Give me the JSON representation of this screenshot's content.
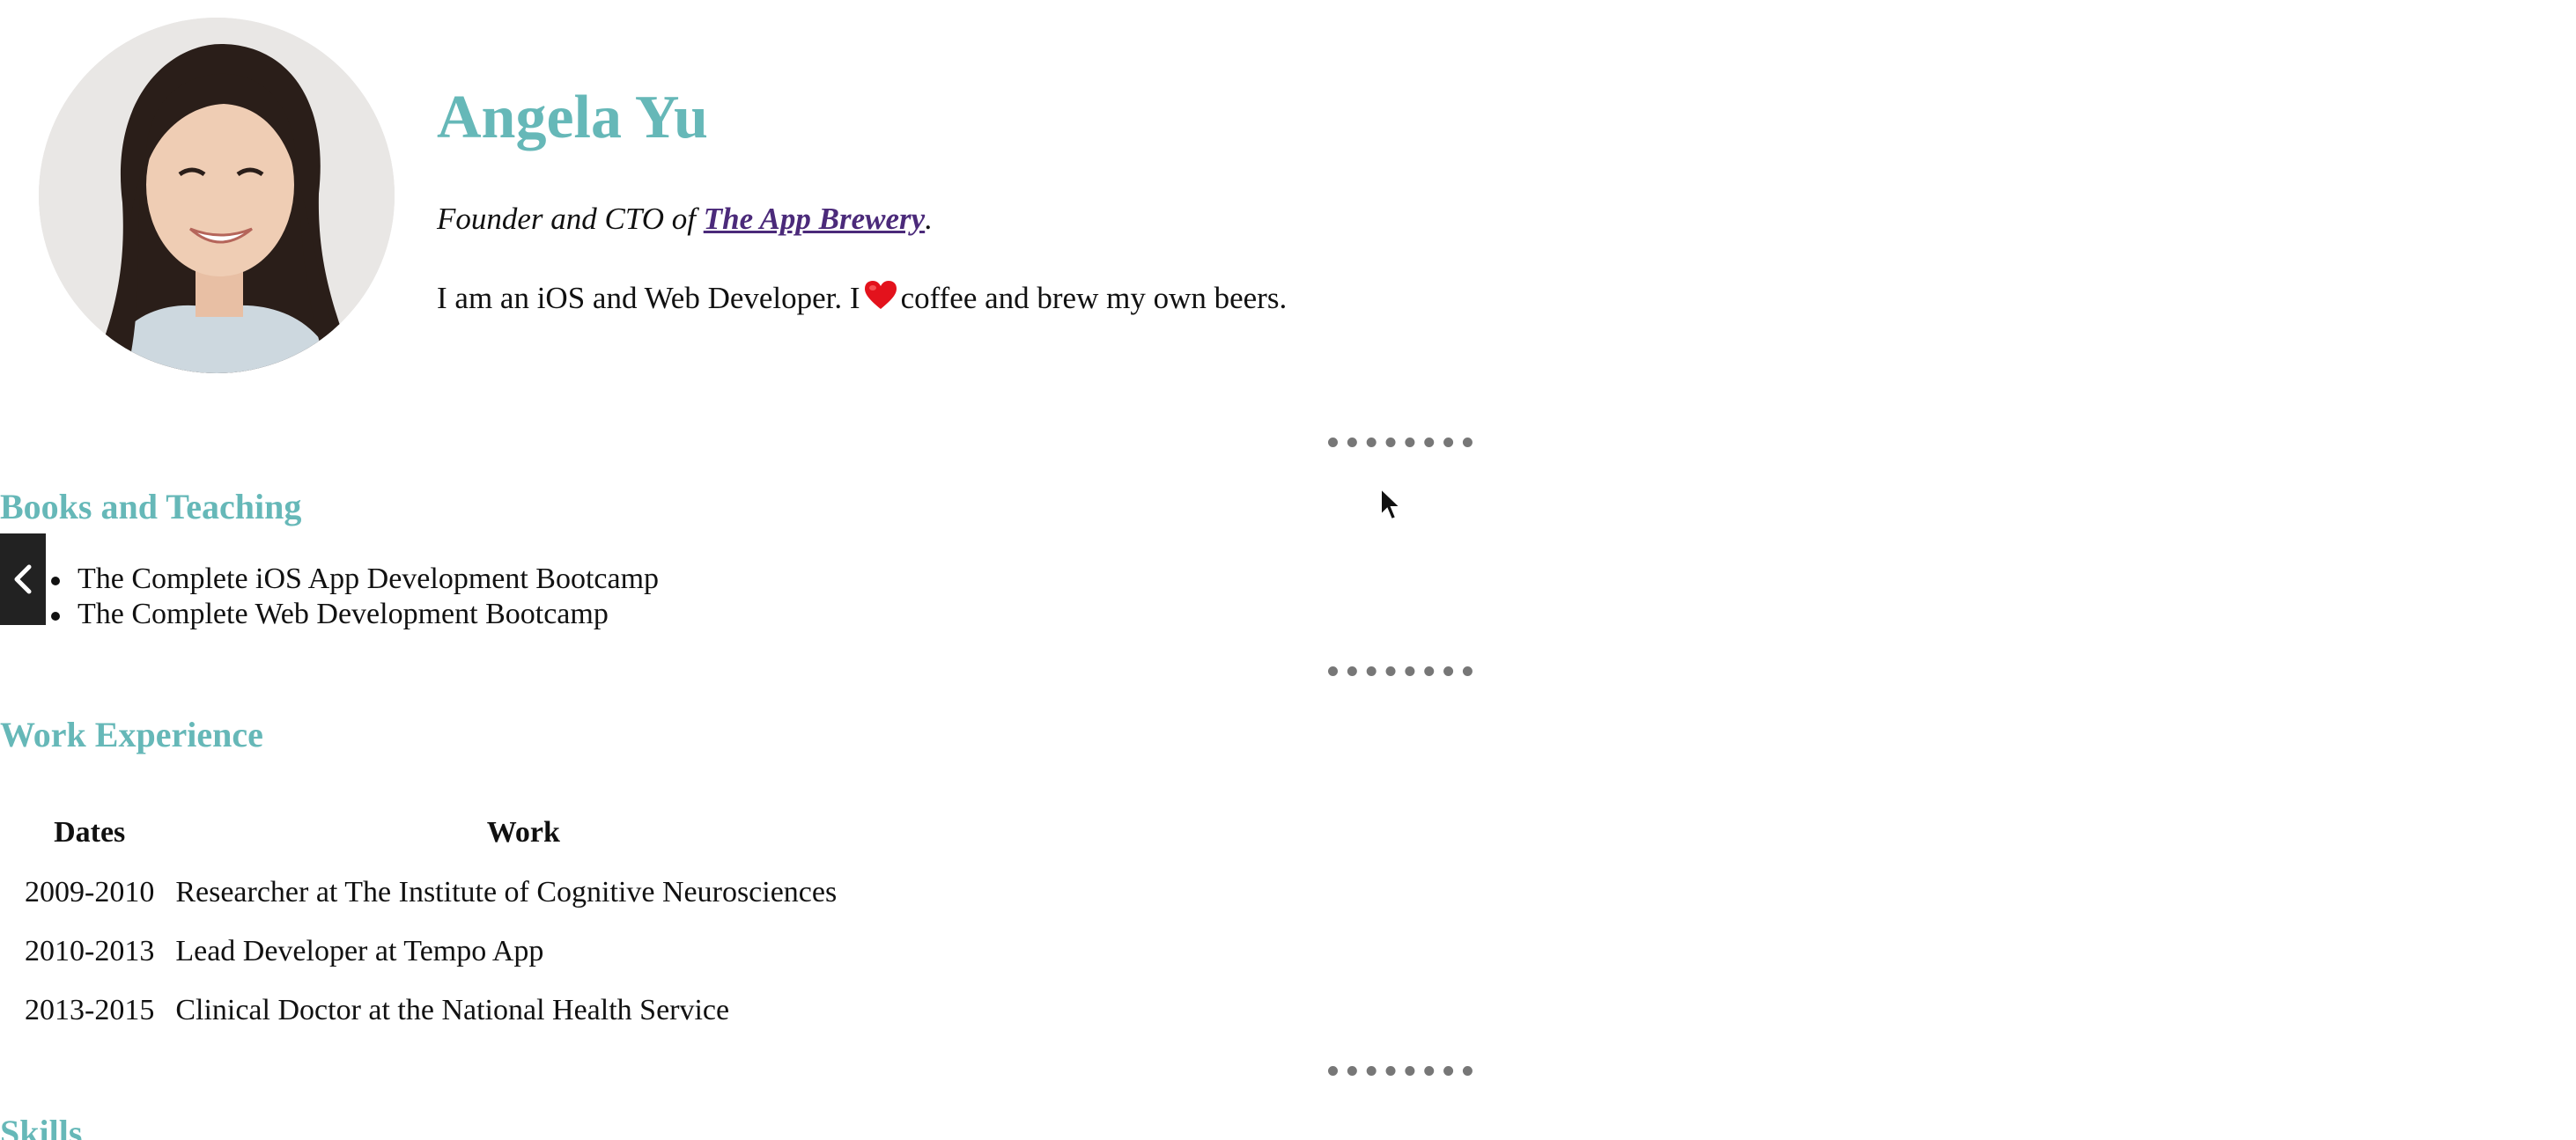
{
  "profile": {
    "name": "Angela Yu",
    "tagline_prefix": "Founder and CTO of ",
    "company_link": "The App Brewery",
    "tagline_suffix": ".",
    "bio_before": "I am an iOS and Web Developer. I",
    "bio_after": "coffee and brew my own beers.",
    "heart_icon": "heart-icon",
    "heart_color": "#e3121c"
  },
  "colors": {
    "heading": "#66b8b8",
    "link": "#4b2a7a",
    "divider": "#777777"
  },
  "books": {
    "title": "Books and Teaching",
    "items": [
      "The Complete iOS App Development Bootcamp",
      "The Complete Web Development Bootcamp"
    ]
  },
  "work": {
    "title": "Work Experience",
    "headers": [
      "Dates",
      "Work"
    ],
    "rows": [
      [
        "2009-2010",
        "Researcher at The Institute of Cognitive Neurosciences"
      ],
      [
        "2010-2013",
        "Lead Developer at Tempo App"
      ],
      [
        "2013-2015",
        "Clinical Doctor at the National Health Service"
      ]
    ]
  },
  "skills": {
    "title": "Skills"
  },
  "overlay": {
    "back_icon": "chevron-left-icon",
    "cursor_icon": "mouse-cursor-icon"
  }
}
